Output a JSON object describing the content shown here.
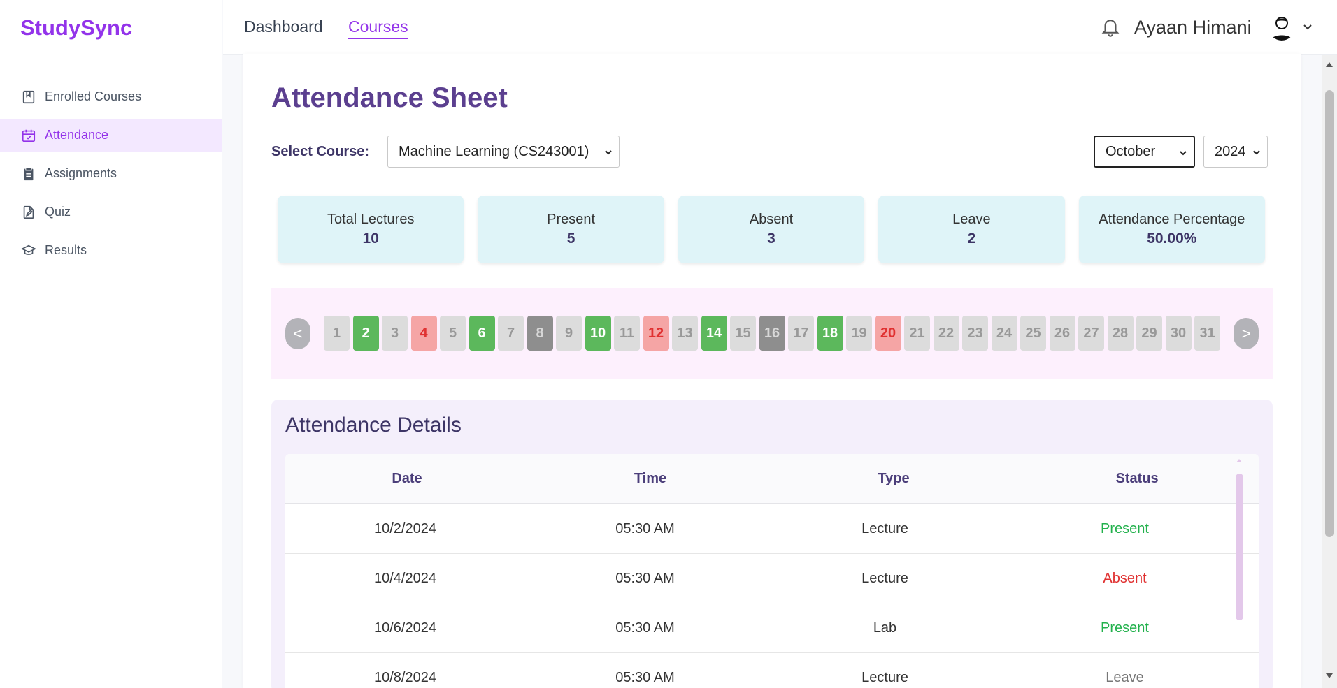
{
  "app": {
    "logo": "StudySync"
  },
  "sidebar": {
    "items": [
      {
        "label": "Enrolled Courses",
        "icon": "bookmark-book-icon",
        "active": false
      },
      {
        "label": "Attendance",
        "icon": "calendar-check-icon",
        "active": true
      },
      {
        "label": "Assignments",
        "icon": "clipboard-icon",
        "active": false
      },
      {
        "label": "Quiz",
        "icon": "file-edit-icon",
        "active": false
      },
      {
        "label": "Results",
        "icon": "graduation-cap-icon",
        "active": false
      }
    ]
  },
  "header": {
    "links": [
      "Dashboard",
      "Courses"
    ],
    "active_link": "Courses",
    "username": "Ayaan Himani",
    "icons": [
      "bell-icon",
      "avatar",
      "chevron-down-icon"
    ]
  },
  "page": {
    "title": "Attendance Sheet",
    "select_course_label": "Select Course:",
    "course_value": "Machine Learning (CS243001)",
    "month_value": "October",
    "year_value": "2024"
  },
  "stats": [
    {
      "label": "Total Lectures",
      "value": "10"
    },
    {
      "label": "Present",
      "value": "5"
    },
    {
      "label": "Absent",
      "value": "3"
    },
    {
      "label": "Leave",
      "value": "2"
    },
    {
      "label": "Attendance Percentage",
      "value": "50.00%"
    }
  ],
  "calendar": {
    "prev_label": "<",
    "next_label": ">",
    "days": [
      {
        "day": "1",
        "status": "none"
      },
      {
        "day": "2",
        "status": "present"
      },
      {
        "day": "3",
        "status": "none"
      },
      {
        "day": "4",
        "status": "absent"
      },
      {
        "day": "5",
        "status": "none"
      },
      {
        "day": "6",
        "status": "present"
      },
      {
        "day": "7",
        "status": "none"
      },
      {
        "day": "8",
        "status": "leave"
      },
      {
        "day": "9",
        "status": "none"
      },
      {
        "day": "10",
        "status": "present"
      },
      {
        "day": "11",
        "status": "none"
      },
      {
        "day": "12",
        "status": "absent"
      },
      {
        "day": "13",
        "status": "none"
      },
      {
        "day": "14",
        "status": "present"
      },
      {
        "day": "15",
        "status": "none"
      },
      {
        "day": "16",
        "status": "leave"
      },
      {
        "day": "17",
        "status": "none"
      },
      {
        "day": "18",
        "status": "present"
      },
      {
        "day": "19",
        "status": "none"
      },
      {
        "day": "20",
        "status": "absent"
      },
      {
        "day": "21",
        "status": "none"
      },
      {
        "day": "22",
        "status": "none"
      },
      {
        "day": "23",
        "status": "none"
      },
      {
        "day": "24",
        "status": "none"
      },
      {
        "day": "25",
        "status": "none"
      },
      {
        "day": "26",
        "status": "none"
      },
      {
        "day": "27",
        "status": "none"
      },
      {
        "day": "28",
        "status": "none"
      },
      {
        "day": "29",
        "status": "none"
      },
      {
        "day": "30",
        "status": "none"
      },
      {
        "day": "31",
        "status": "none"
      }
    ]
  },
  "details": {
    "title": "Attendance Details",
    "columns": [
      "Date",
      "Time",
      "Type",
      "Status"
    ],
    "rows": [
      {
        "date": "10/2/2024",
        "time": "05:30 AM",
        "type": "Lecture",
        "status": "Present"
      },
      {
        "date": "10/4/2024",
        "time": "05:30 AM",
        "type": "Lecture",
        "status": "Absent"
      },
      {
        "date": "10/6/2024",
        "time": "05:30 AM",
        "type": "Lab",
        "status": "Present"
      },
      {
        "date": "10/8/2024",
        "time": "05:30 AM",
        "type": "Lecture",
        "status": "Leave"
      }
    ]
  },
  "colors": {
    "brand": "#9333ea",
    "present": "#5cb85c",
    "absent": "#f5a5a5",
    "leave": "#8e8e8e",
    "stat_bg": "#dff4f8"
  }
}
